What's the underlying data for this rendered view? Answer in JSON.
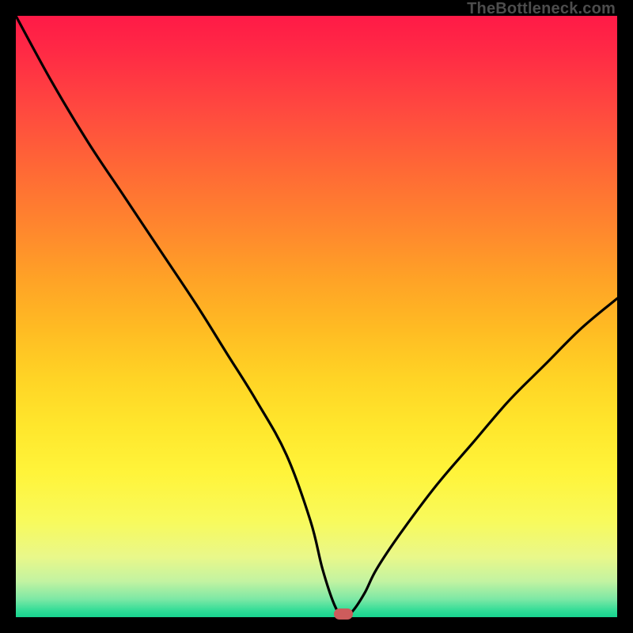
{
  "attribution": "TheBottleneck.com",
  "colors": {
    "frame_bg": "#000000",
    "marker": "#cd5c5c",
    "curve": "#000000"
  },
  "chart_data": {
    "type": "line",
    "title": "",
    "xlabel": "",
    "ylabel": "",
    "xlim": [
      0,
      100
    ],
    "ylim": [
      0,
      100
    ],
    "series": [
      {
        "name": "bottleneck-curve",
        "x": [
          0,
          6,
          12,
          18,
          24,
          30,
          35,
          40,
          45,
          49,
          51,
          53,
          54.5,
          56,
          58,
          60,
          64,
          70,
          76,
          82,
          88,
          94,
          100
        ],
        "y": [
          100,
          89,
          79,
          70,
          61,
          52,
          44,
          36,
          27,
          16,
          8,
          2,
          0,
          1,
          4,
          8,
          14,
          22,
          29,
          36,
          42,
          48,
          53
        ]
      }
    ],
    "marker": {
      "x": 54.5,
      "y": 0
    },
    "gradient_stops": [
      {
        "pos": 0,
        "color": "#ff1a47"
      },
      {
        "pos": 50,
        "color": "#ffbb23"
      },
      {
        "pos": 85,
        "color": "#f8fa5c"
      },
      {
        "pos": 100,
        "color": "#17d38f"
      }
    ]
  }
}
